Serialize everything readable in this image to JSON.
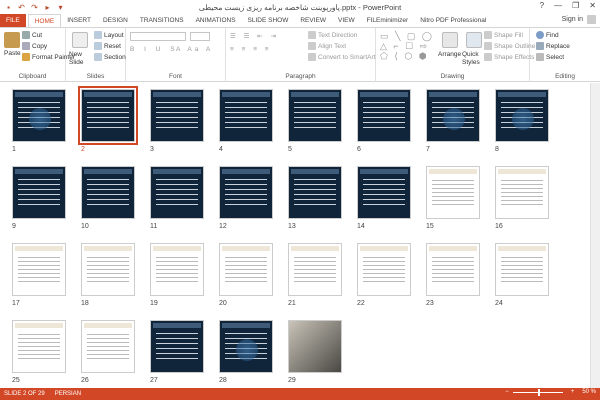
{
  "window": {
    "title": "پاورپوینت شاخصه برنامه ریزی زیست محیطی.pptx - PowerPoint",
    "controls": [
      "?",
      "—",
      "❐",
      "✕"
    ]
  },
  "qat": [
    "save-icon",
    "undo-icon",
    "redo-icon",
    "start-icon",
    "customize-icon"
  ],
  "tabs": [
    "FILE",
    "HOME",
    "INSERT",
    "DESIGN",
    "TRANSITIONS",
    "ANIMATIONS",
    "SLIDE SHOW",
    "REVIEW",
    "VIEW",
    "FILEminimizer",
    "Nitro PDF Professional"
  ],
  "sign_in": "Sign in",
  "ribbon": {
    "clipboard": {
      "title": "Clipboard",
      "paste": "Paste",
      "cut": "Cut",
      "copy": "Copy",
      "format_painter": "Format Painter"
    },
    "slides": {
      "title": "Slides",
      "new_slide": "New Slide",
      "layout": "Layout",
      "reset": "Reset",
      "section": "Section"
    },
    "font": {
      "title": "Font"
    },
    "paragraph": {
      "title": "Paragraph",
      "text_direction": "Text Direction",
      "align_text": "Align Text",
      "convert": "Convert to SmartArt"
    },
    "drawing": {
      "title": "Drawing",
      "arrange": "Arrange",
      "quick_styles": "Quick Styles",
      "shape_fill": "Shape Fill",
      "shape_outline": "Shape Outline",
      "shape_effects": "Shape Effects"
    },
    "editing": {
      "title": "Editing",
      "find": "Find",
      "replace": "Replace",
      "select": "Select"
    }
  },
  "slides": [
    {
      "n": "1",
      "style": "dark",
      "globe": true
    },
    {
      "n": "2",
      "style": "dark",
      "selected": true
    },
    {
      "n": "3",
      "style": "dark"
    },
    {
      "n": "4",
      "style": "dark"
    },
    {
      "n": "5",
      "style": "dark"
    },
    {
      "n": "6",
      "style": "dark"
    },
    {
      "n": "7",
      "style": "dark",
      "globe": true
    },
    {
      "n": "8",
      "style": "dark",
      "globe": true
    },
    {
      "n": "9",
      "style": "dark"
    },
    {
      "n": "10",
      "style": "dark"
    },
    {
      "n": "11",
      "style": "dark"
    },
    {
      "n": "12",
      "style": "dark"
    },
    {
      "n": "13",
      "style": "dark"
    },
    {
      "n": "14",
      "style": "dark"
    },
    {
      "n": "15",
      "style": "light"
    },
    {
      "n": "16",
      "style": "light"
    },
    {
      "n": "17",
      "style": "light"
    },
    {
      "n": "18",
      "style": "light"
    },
    {
      "n": "19",
      "style": "light"
    },
    {
      "n": "20",
      "style": "light"
    },
    {
      "n": "21",
      "style": "light"
    },
    {
      "n": "22",
      "style": "light"
    },
    {
      "n": "23",
      "style": "light"
    },
    {
      "n": "24",
      "style": "light"
    },
    {
      "n": "25",
      "style": "light"
    },
    {
      "n": "26",
      "style": "light"
    },
    {
      "n": "27",
      "style": "dark"
    },
    {
      "n": "28",
      "style": "dark",
      "globe": true
    },
    {
      "n": "29",
      "style": "photo"
    }
  ],
  "status": {
    "slide": "SLIDE 2 OF 29",
    "language": "PERSIAN",
    "zoom": "50 %"
  },
  "colors": {
    "accent": "#d24726"
  }
}
